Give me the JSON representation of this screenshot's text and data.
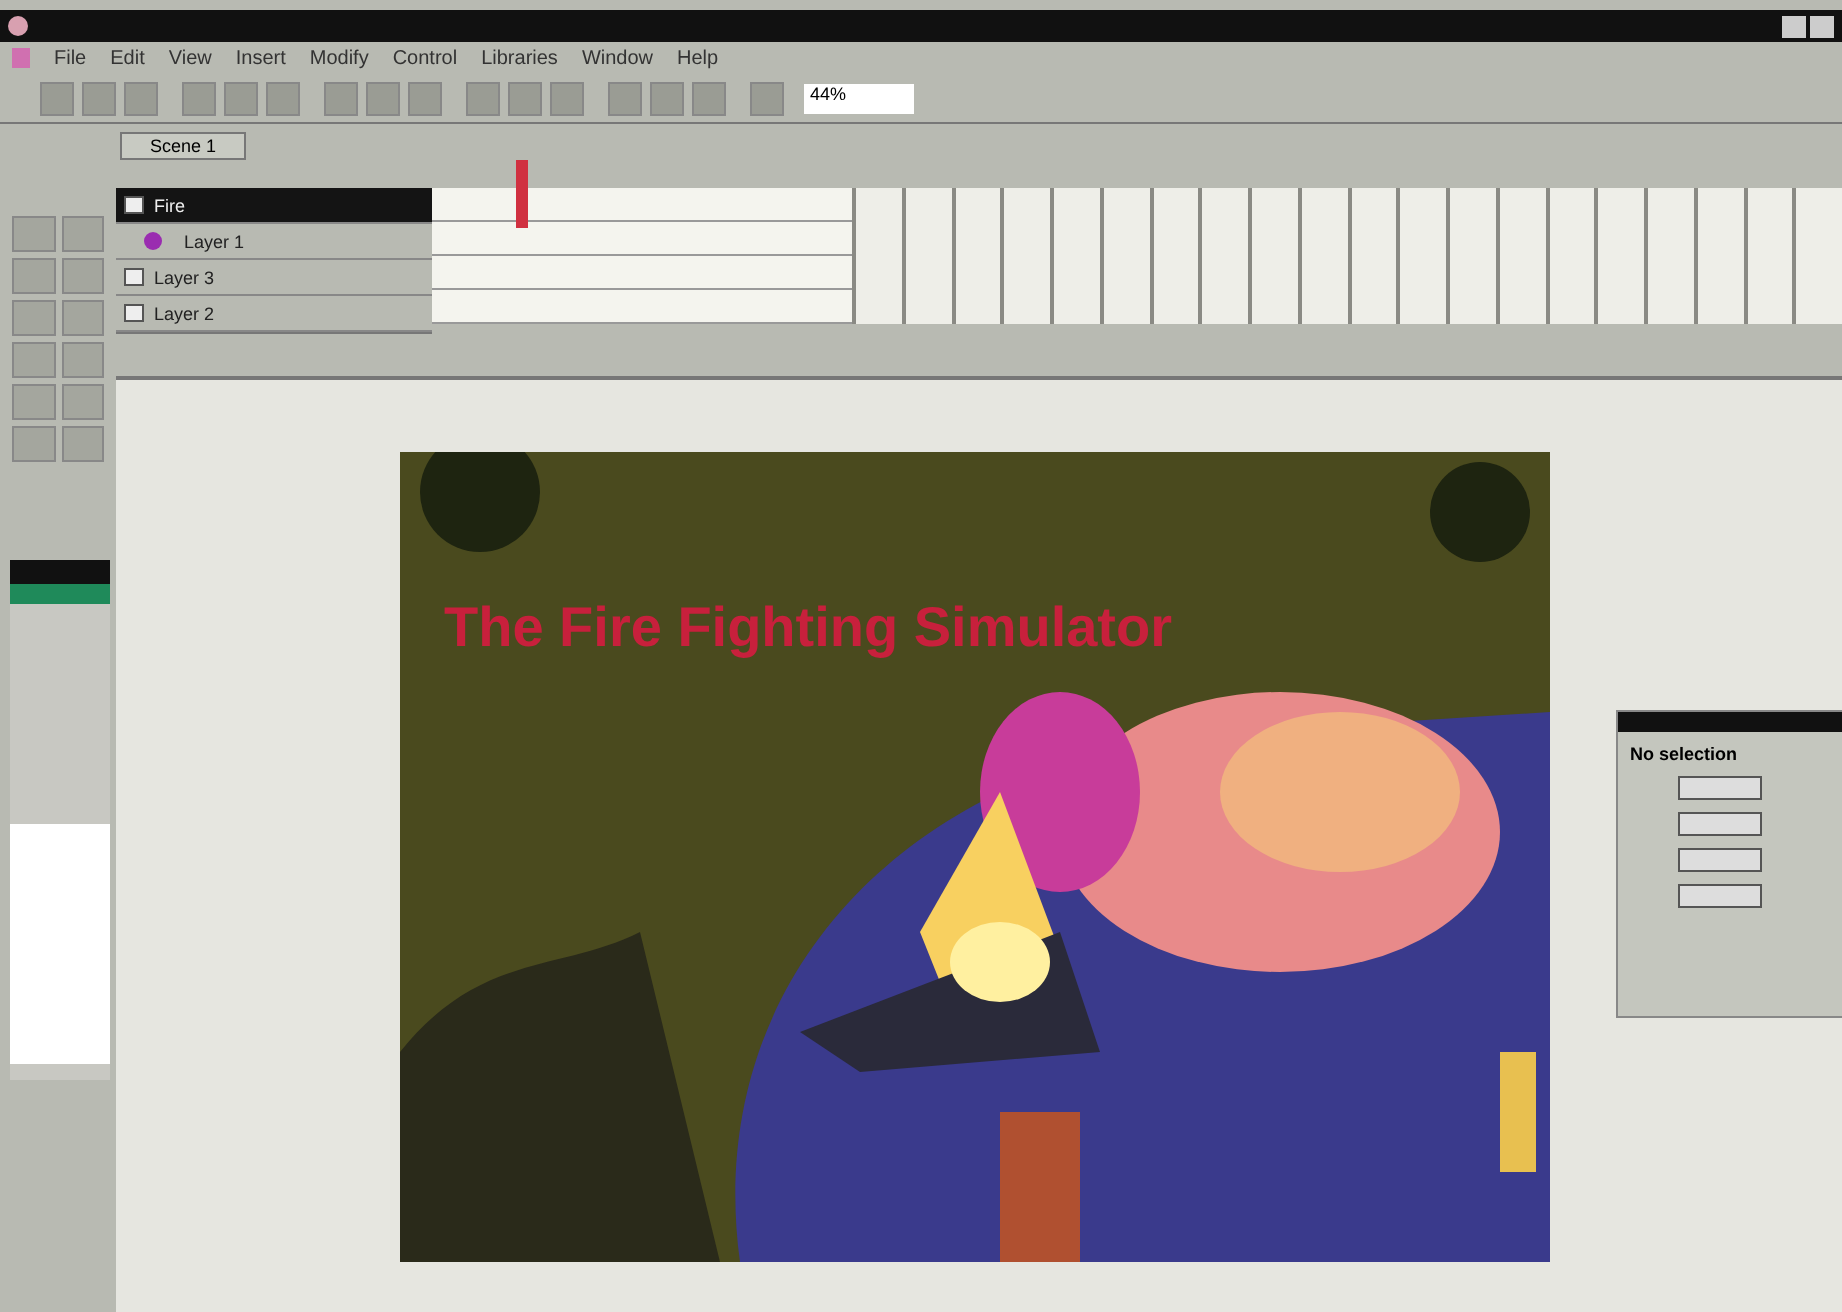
{
  "menu": [
    "File",
    "Edit",
    "View",
    "Insert",
    "Modify",
    "Control",
    "Libraries",
    "Window",
    "Help"
  ],
  "zoom": {
    "value": "44%"
  },
  "scene": {
    "label": "Scene 1"
  },
  "layers": [
    {
      "name": "Fire",
      "selected": true,
      "kind": "layer"
    },
    {
      "name": "Layer 1",
      "selected": false,
      "kind": "guide"
    },
    {
      "name": "Layer 3",
      "selected": false,
      "kind": "layer"
    },
    {
      "name": "Layer 2",
      "selected": false,
      "kind": "layer"
    }
  ],
  "playhead": {
    "level": 0.2
  },
  "stage": {
    "kind": "picture",
    "title": "The Fire Fighting Simulator"
  },
  "panel": {
    "status": "No selection"
  }
}
